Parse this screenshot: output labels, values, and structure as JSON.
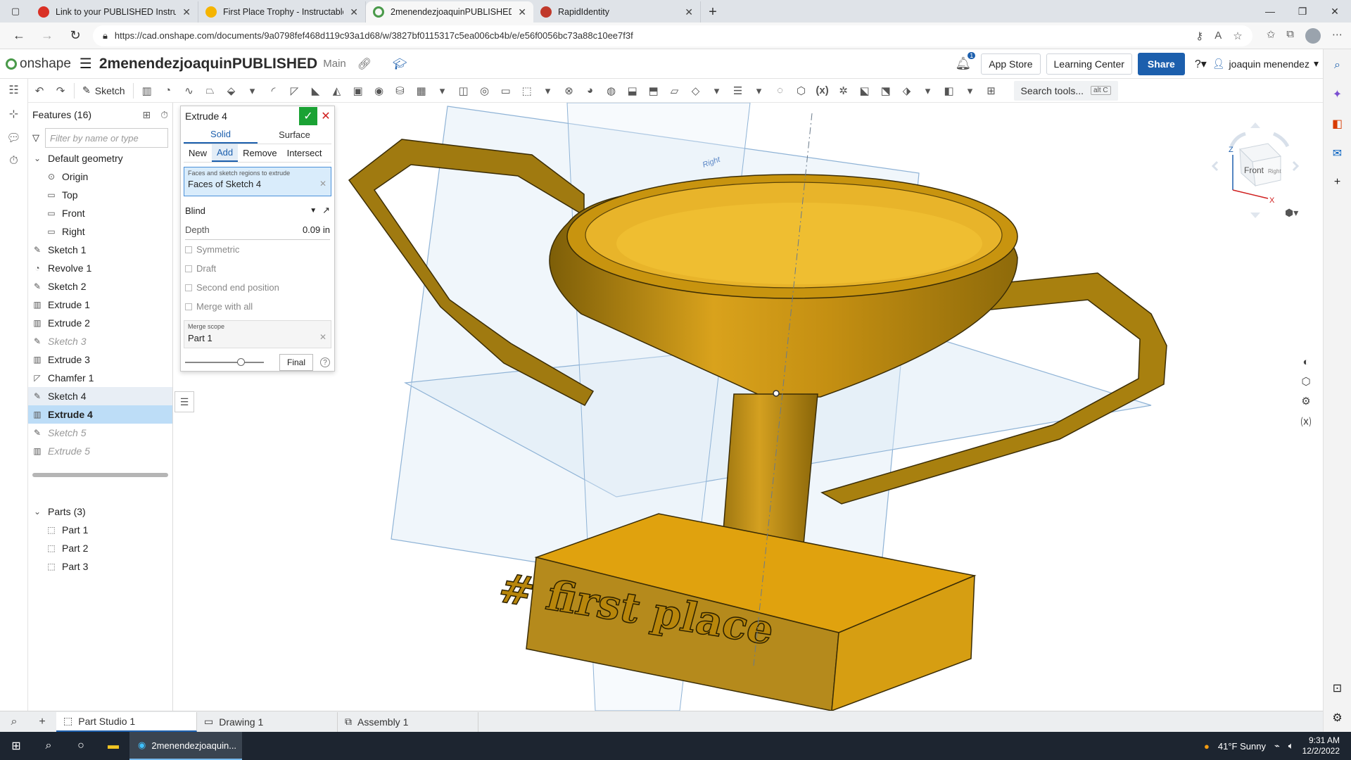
{
  "browser": {
    "tabs": [
      {
        "title": "Link to your PUBLISHED Instructables",
        "color": "#d93025",
        "active": false
      },
      {
        "title": "First Place Trophy - Instructables",
        "color": "#f5b400",
        "active": false
      },
      {
        "title": "2menendezjoaquinPUBLISHED |",
        "color": "#4a9a4a",
        "active": true
      },
      {
        "title": "RapidIdentity",
        "color": "#c0392b",
        "active": false
      }
    ],
    "url": "https://cad.onshape.com/documents/9a0798fef468d119c93a1d68/w/3827bf0115317c5ea006cb4b/e/e56f0056bc73a88c10ee7f3f"
  },
  "header": {
    "logo_text": "onshape",
    "doc_name": "2menendezjoaquinPUBLISHED",
    "branch": "Main",
    "notif_count": "1",
    "app_store": "App Store",
    "learning_center": "Learning Center",
    "share": "Share",
    "user": "joaquin menendez"
  },
  "toolbar": {
    "sketch_label": "Sketch",
    "search_label": "Search tools...",
    "search_kbd": "alt C"
  },
  "features": {
    "title": "Features (16)",
    "filter_placeholder": "Filter by name or type",
    "default_geometry": "Default geometry",
    "geometry": [
      "Origin",
      "Top",
      "Front",
      "Right"
    ],
    "items": [
      {
        "label": "Sketch 1",
        "icon": "sketch-icon",
        "state": ""
      },
      {
        "label": "Revolve 1",
        "icon": "revolve-icon",
        "state": ""
      },
      {
        "label": "Sketch 2",
        "icon": "sketch-icon",
        "state": ""
      },
      {
        "label": "Extrude 1",
        "icon": "extrude-icon",
        "state": ""
      },
      {
        "label": "Extrude 2",
        "icon": "extrude-icon",
        "state": ""
      },
      {
        "label": "Sketch 3",
        "icon": "sketch-icon",
        "state": "dim"
      },
      {
        "label": "Extrude 3",
        "icon": "extrude-icon",
        "state": ""
      },
      {
        "label": "Chamfer 1",
        "icon": "chamfer-icon",
        "state": ""
      },
      {
        "label": "Sketch 4",
        "icon": "sketch-icon",
        "state": "hov"
      },
      {
        "label": "Extrude 4",
        "icon": "extrude-icon",
        "state": "sel"
      },
      {
        "label": "Sketch 5",
        "icon": "sketch-icon",
        "state": "dim"
      },
      {
        "label": "Extrude 5",
        "icon": "extrude-icon",
        "state": "dim"
      }
    ],
    "parts_title": "Parts (3)",
    "parts": [
      "Part 1",
      "Part 2",
      "Part 3"
    ]
  },
  "dialog": {
    "title": "Extrude 4",
    "type_tabs": [
      "Solid",
      "Surface"
    ],
    "ops": [
      "New",
      "Add",
      "Remove",
      "Intersect"
    ],
    "selection_label": "Faces and sketch regions to extrude",
    "selection_value": "Faces of Sketch 4",
    "end_type": "Blind",
    "depth_label": "Depth",
    "depth_value": "0.09 in",
    "checks": [
      "Symmetric",
      "Draft",
      "Second end position",
      "Merge with all"
    ],
    "merge_scope_label": "Merge scope",
    "merge_scope_value": "Part 1",
    "final": "Final",
    "help": "?"
  },
  "viewport": {
    "plane_label": "Right",
    "engraving": "# first place"
  },
  "viewcube": {
    "front": "Front",
    "right": "Right",
    "z": "Z",
    "x": "X"
  },
  "bottom_tabs": [
    "Part Studio 1",
    "Drawing 1",
    "Assembly 1"
  ],
  "taskbar": {
    "app": "2menendezjoaquin...",
    "weather": "41°F  Sunny",
    "time": "9:31 AM",
    "date": "12/2/2022"
  },
  "colors": {
    "accent": "#1c5fad",
    "trophy": "#c9961a",
    "confirm": "#1aa234",
    "cancel": "#d01f1f"
  }
}
